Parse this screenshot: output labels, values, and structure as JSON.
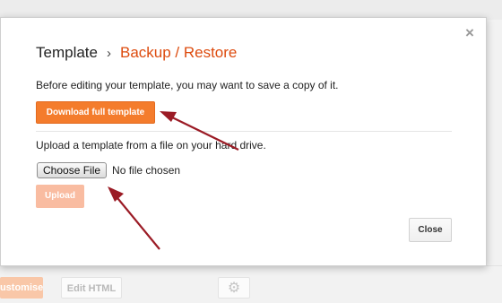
{
  "background": {
    "customise_label": "Customise",
    "edit_html_label": "Edit HTML",
    "gear_icon": "gear-icon"
  },
  "dialog": {
    "title": "Template",
    "separator": "›",
    "subtitle": "Backup / Restore",
    "close_x": "×",
    "save_prompt": "Before editing your template, you may want to save a copy of it.",
    "download_label": "Download full template",
    "upload_prompt": "Upload a template from a file on your hard drive.",
    "choose_file_label": "Choose File",
    "no_file_text": "No file chosen",
    "upload_label": "Upload",
    "close_label": "Close"
  },
  "colors": {
    "accent_orange": "#f47c2c",
    "title_orange": "#dd4b0e",
    "arrow_red": "#9b1b25"
  }
}
